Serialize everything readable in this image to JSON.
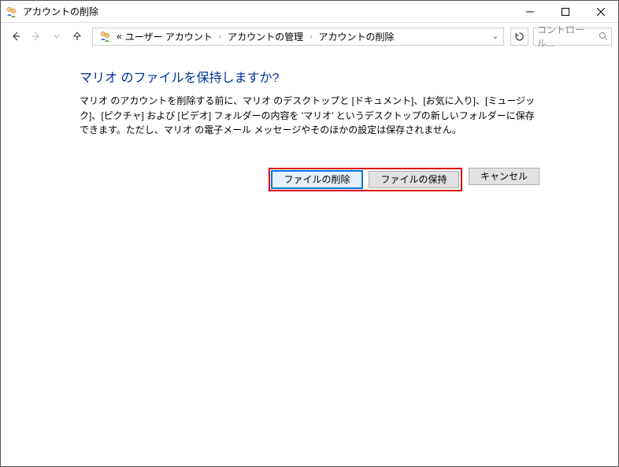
{
  "title": "アカウントの削除",
  "breadcrumb": {
    "sep_prefix": "«",
    "items": [
      "ユーザー アカウント",
      "アカウントの管理",
      "アカウントの削除"
    ]
  },
  "search": {
    "placeholder": "コントロール..."
  },
  "main": {
    "heading": "マリオ のファイルを保持しますか?",
    "body": "マリオ のアカウントを削除する前に、マリオ のデスクトップと [ドキュメント]、[お気に入り]、[ミュージック]、[ピクチャ] および [ビデオ] フォルダーの内容を 'マリオ' というデスクトップの新しいフォルダーに保存できます。ただし、マリオ の電子メール メッセージやそのほかの設定は保存されません。"
  },
  "buttons": {
    "delete_files": "ファイルの削除",
    "keep_files": "ファイルの保持",
    "cancel": "キャンセル"
  }
}
